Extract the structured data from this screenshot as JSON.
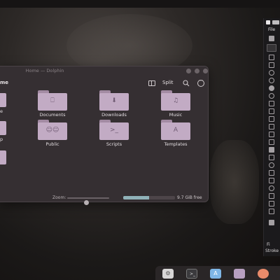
{
  "dolphin": {
    "title": "Home — Dolphin",
    "breadcrumb": "me",
    "split_label": "Split",
    "folders": [
      {
        "label": "Documents",
        "icon": "document-icon",
        "glyph": "⎕"
      },
      {
        "label": "Downloads",
        "icon": "download-icon",
        "glyph": "⬇"
      },
      {
        "label": "Music",
        "icon": "music-icon",
        "glyph": "♫"
      },
      {
        "label": "Public",
        "icon": "people-icon",
        "glyph": "☺☺"
      },
      {
        "label": "Scripts",
        "icon": "terminal-icon",
        "glyph": ">_"
      },
      {
        "label": "Templates",
        "icon": "template-icon",
        "glyph": "A"
      }
    ],
    "partial_labels": [
      "e",
      "p"
    ],
    "zoom_label": "Zoom:",
    "zoom_level": 0.45,
    "space_used_fraction": 0.5,
    "free_space": "9.7 GiB free"
  },
  "right_app": {
    "menu_file": "File",
    "bottom_labels": [
      "Fi",
      "Stroke"
    ]
  },
  "dock": {
    "icons": [
      "settings-icon",
      "terminal-icon",
      "app-store-icon",
      "file-manager-icon",
      "browser-icon"
    ]
  },
  "colors": {
    "folder": "#c2abc4",
    "window_bg": "#352f32",
    "space_fill": "#8fb1b8"
  }
}
